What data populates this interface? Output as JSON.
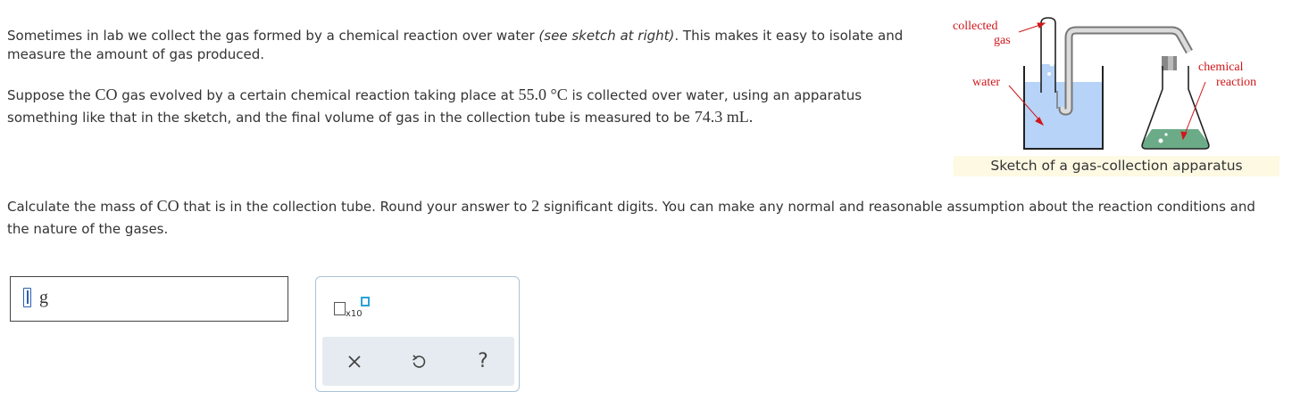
{
  "problem": {
    "p1_text": "Sometimes in lab we collect the gas formed by a chemical reaction over water ",
    "p1_italic": "(see sketch at right)",
    "p1_end": ". This makes it easy to isolate and measure the amount of gas produced.",
    "p2_a": "Suppose the ",
    "p2_gas": "CO",
    "p2_b": " gas evolved by a certain chemical reaction taking place at ",
    "p2_temp": "55.0 °C",
    "p2_c": " is collected over water, using an apparatus something like that in the sketch, and the final volume of gas in the collection tube is measured to be ",
    "p2_vol": "74.3 mL",
    "p2_end": ".",
    "p3_a": "Calculate the mass of ",
    "p3_gas": "CO",
    "p3_b": " that is in the collection tube. Round your answer to ",
    "p3_sig": "2",
    "p3_c": " significant digits. You can make any normal and reasonable assumption about the reaction conditions and the nature of the gases."
  },
  "sketch": {
    "label_collected": "collected",
    "label_gas": "gas",
    "label_water": "water",
    "label_chemical": "chemical",
    "label_reaction": "reaction",
    "caption": "Sketch of a gas-collection apparatus",
    "colors": {
      "water": "#b7d3f7",
      "reaction": "#6cab88",
      "label": "#d0171b",
      "caption_bg": "#fdf9e3"
    }
  },
  "answer": {
    "value": "",
    "unit": "g"
  },
  "tools": {
    "x10_label": "x10",
    "clear_icon": "close-icon",
    "undo_icon": "undo-icon",
    "help_icon": "help-icon",
    "help_label": "?"
  }
}
